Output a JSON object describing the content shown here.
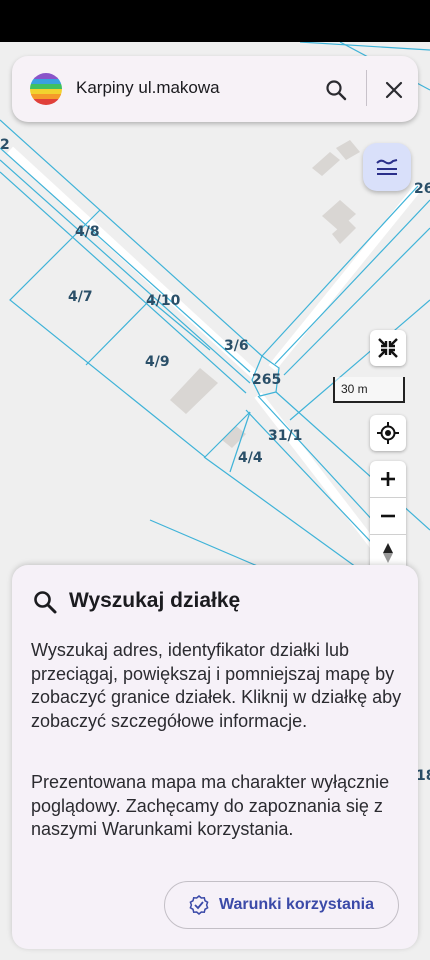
{
  "search": {
    "value": "Karpiny ul.makowa",
    "icon": "search-icon",
    "close_icon": "close-icon"
  },
  "map": {
    "parcel_labels": [
      "2",
      "4/8",
      "4/7",
      "4/10",
      "4/9",
      "3/6",
      "265",
      "31/1",
      "4/4",
      "26",
      "18"
    ],
    "scale_label": "30 m",
    "parcel_line_color": "#3fb3d8"
  },
  "controls": {
    "layers_icon": "layers-icon",
    "fullscreen_icon": "fullscreen-exit-icon",
    "locate_icon": "my-location-icon",
    "zoom_in_icon": "plus-icon",
    "zoom_out_icon": "minus-icon",
    "compass_icon": "compass-icon"
  },
  "sheet": {
    "title": "Wyszukaj działkę",
    "paragraph1": "Wyszukaj adres, identyfikator działki lub przeciągaj, powiększaj i pomniejszaj mapę by zobaczyć granice działek. Kliknij w działkę aby zobaczyć szczegółowe informacje.",
    "paragraph2": "Prezentowana mapa ma charakter wyłącznie poglądowy. Zachęcamy do zapoznania się z naszymi Warunkami korzystania.",
    "terms_button": "Warunki korzystania",
    "accent_color": "#3b4aa8"
  }
}
